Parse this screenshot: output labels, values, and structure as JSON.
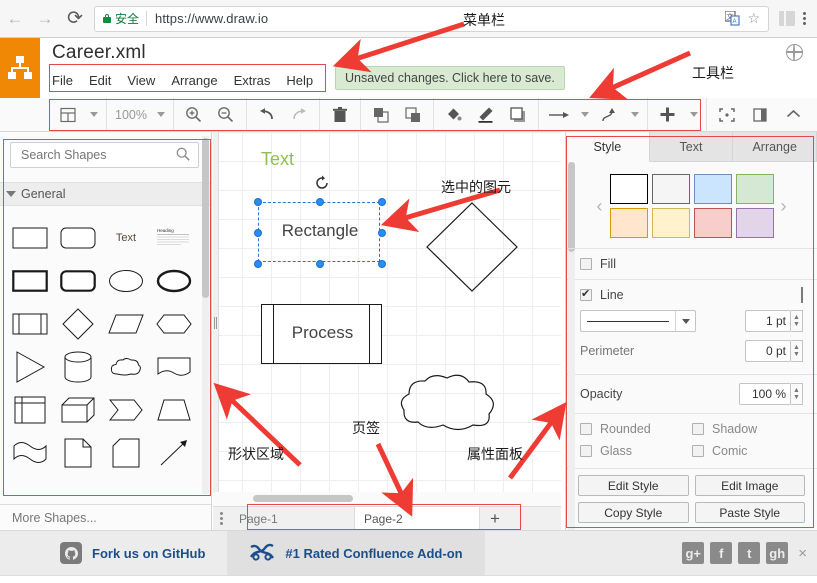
{
  "browser": {
    "back_icon": "back-arrow-icon",
    "forward_icon": "forward-arrow-icon",
    "reload_icon": "reload-icon",
    "security_label": "安全",
    "url": "https://www.draw.io",
    "translate_icon": "translate-icon",
    "bookmark_icon": "star-icon",
    "extension_icon": "extension-icon",
    "menu_icon": "kebab-menu-icon"
  },
  "app": {
    "logo_alt": "drawio-logo",
    "title": "Career.xml",
    "language_icon": "globe-icon",
    "menu_items": [
      "File",
      "Edit",
      "View",
      "Arrange",
      "Extras",
      "Help"
    ],
    "save_notice": "Unsaved changes. Click here to save."
  },
  "toolbar": {
    "view_icon": "view-layout-icon",
    "zoom_value": "100%",
    "zoom_in_icon": "zoom-in-icon",
    "zoom_out_icon": "zoom-out-icon",
    "undo_icon": "undo-icon",
    "redo_icon": "redo-icon",
    "delete_icon": "trash-icon",
    "to_front_icon": "bring-to-front-icon",
    "to_back_icon": "send-to-back-icon",
    "fill_icon": "fill-color-icon",
    "line_icon": "line-color-icon",
    "shadow_icon": "shadow-icon",
    "connection_icon": "connection-arrow-icon",
    "waypoints_icon": "waypoints-icon",
    "insert_icon": "insert-plus-icon",
    "fullscreen_icon": "fullscreen-icon",
    "format_panel_icon": "format-panel-icon",
    "collapse_icon": "collapse-chevron-icon"
  },
  "shapes_panel": {
    "search_placeholder": "Search Shapes",
    "search_value": "",
    "search_icon": "search-icon",
    "section_title": "General",
    "more_shapes": "More Shapes...",
    "items": [
      "rectangle",
      "rounded-rectangle",
      "text",
      "textbox",
      "square-thick",
      "rounded-thick",
      "ellipse",
      "ellipse-thick",
      "process",
      "diamond",
      "parallelogram",
      "hexagon",
      "triangle",
      "cylinder",
      "cloud",
      "document",
      "internal-storage",
      "cube",
      "step",
      "trapezoid",
      "tape",
      "note",
      "card",
      "line"
    ],
    "text_sample": "Text",
    "textbox_sample": "Heading"
  },
  "canvas": {
    "text_shape_label": "Text",
    "rotate_icon": "rotate-handle-icon",
    "selected_shape_label": "Rectangle",
    "process_shape_label": "Process",
    "diamond_shape": "diamond",
    "cloud_shape": "cloud"
  },
  "format_panel": {
    "tabs": [
      {
        "label": "Style",
        "active": true
      },
      {
        "label": "Text",
        "active": false
      },
      {
        "label": "Arrange",
        "active": false
      }
    ],
    "prev_icon": "chevron-left-icon",
    "next_icon": "chevron-right-icon",
    "swatches": [
      "#ffffff",
      "#f5f5f5",
      "#cce5ff",
      "#d5e8d4",
      "#ffe6cc",
      "#fff2cc",
      "#f8cecc",
      "#e1d5e7"
    ],
    "swatch_borders": [
      "#000000",
      "#666666",
      "#6c8ebf",
      "#82b366",
      "#d79b00",
      "#d6b656",
      "#b85450",
      "#9673a6"
    ],
    "fill_label": "Fill",
    "fill_checked": false,
    "line_label": "Line",
    "line_checked": true,
    "line_color": "#2b2b2b",
    "line_width": "1 pt",
    "perimeter_label": "Perimeter",
    "perimeter_value": "0 pt",
    "opacity_label": "Opacity",
    "opacity_value": "100 %",
    "rounded_label": "Rounded",
    "shadow_label": "Shadow",
    "glass_label": "Glass",
    "comic_label": "Comic",
    "edit_style": "Edit Style",
    "edit_image": "Edit Image",
    "copy_style": "Copy Style",
    "paste_style": "Paste Style"
  },
  "pages": {
    "menu_icon": "page-menu-icon",
    "tabs": [
      {
        "label": "Page-1",
        "active": false
      },
      {
        "label": "Page-2",
        "active": true
      }
    ],
    "add_label": "+"
  },
  "footer": {
    "github_icon": "github-icon",
    "github_label": "Fork us on GitHub",
    "confluence_icon": "confluence-addon-icon",
    "confluence_label": "#1 Rated Confluence Add-on",
    "social": [
      "g+",
      "f",
      "t",
      "gh"
    ],
    "close_label": "×"
  },
  "annotations": {
    "accent_color": "#ee3b33",
    "items": [
      {
        "id": "menubar",
        "text": "菜单栏"
      },
      {
        "id": "toolbar",
        "text": "工具栏"
      },
      {
        "id": "selected",
        "text": "选中的图元"
      },
      {
        "id": "shapes-area",
        "text": "形状区域"
      },
      {
        "id": "page-tabs",
        "text": "页签"
      },
      {
        "id": "format-panel",
        "text": "属性面板"
      }
    ]
  }
}
